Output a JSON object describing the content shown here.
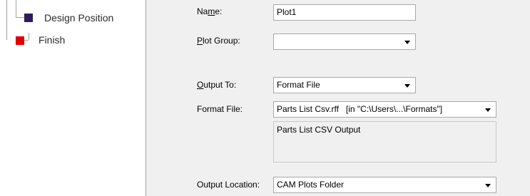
{
  "tree": {
    "items": [
      {
        "label": "Design Position",
        "color": "#2e1a5c"
      },
      {
        "label": "Finish",
        "color": "#e00000"
      }
    ]
  },
  "form": {
    "name": {
      "label_pre": "Na",
      "label_key": "m",
      "label_post": "e:",
      "value": "Plot1"
    },
    "plot_group": {
      "label_key": "P",
      "label_post": "lot Group:",
      "value": ""
    },
    "output_to": {
      "label_key": "O",
      "label_post": "utput To:",
      "value": "Format File"
    },
    "format_file": {
      "label": "Format File:",
      "value": "Parts List Csv.rff   [in \"C:\\Users\\...\\Formats\"]",
      "description": "Parts List CSV Output"
    },
    "output_location": {
      "label": "Output Location:",
      "value": "CAM Plots Folder"
    }
  }
}
